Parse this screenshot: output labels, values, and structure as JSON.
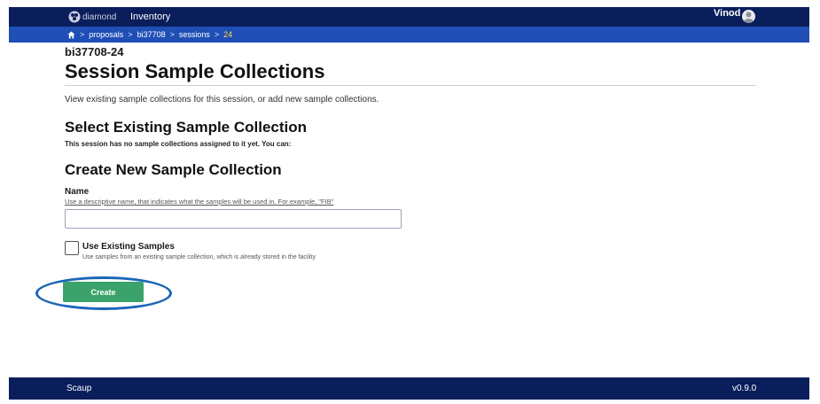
{
  "topbar": {
    "logo_text": "diamond",
    "nav_inventory": "Inventory",
    "user_name": "Vinod"
  },
  "breadcrumb": {
    "items": [
      "proposals",
      "bi37708",
      "sessions"
    ],
    "current": "24",
    "separator": ">"
  },
  "page": {
    "session_id": "bi37708-24",
    "title": "Session Sample Collections",
    "intro": "View existing sample collections for this session, or add new sample collections."
  },
  "existing": {
    "heading": "Select Existing Sample Collection",
    "note": "This session has no sample collections assigned to it yet. You can:"
  },
  "create": {
    "heading": "Create New Sample Collection",
    "name_label": "Name",
    "name_help": "Use a descriptive name, that indicates what the samples will be used in. For example, \"FIB\"",
    "name_value": "",
    "use_existing_label": "Use Existing Samples",
    "use_existing_help": "Use samples from an existing sample collection, which is already stored in the facility",
    "use_existing_checked": false,
    "create_button": "Create"
  },
  "footer": {
    "brand": "Scaup",
    "version": "v0.9.0"
  },
  "colors": {
    "nav_bg": "#0a1e5c",
    "breadcrumb_bg": "#1f4fb5",
    "breadcrumb_current": "#ffd84a",
    "create_button": "#3aa26a",
    "highlight_ring": "#1a66b8"
  }
}
